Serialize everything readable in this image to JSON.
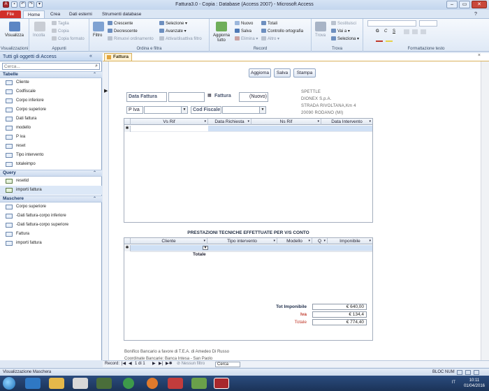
{
  "window": {
    "title": "Fattura3.0 - Copia : Database (Access 2007) - Microsoft Access",
    "controls": [
      "–",
      "▭",
      "✕"
    ]
  },
  "ribbon": {
    "tabs": [
      "File",
      "Home",
      "Crea",
      "Dati esterni",
      "Strumenti database"
    ],
    "groups": {
      "views": {
        "label": "Visualizzazioni",
        "view_button": "Visualizza"
      },
      "clipboard": {
        "label": "Appunti",
        "paste": "Incolla",
        "cut": "Taglia",
        "copy": "Copia",
        "format_painter": "Copia formato"
      },
      "sort_filter": {
        "label": "Ordina e filtra",
        "filter": "Filtro",
        "ascending": "Crescente",
        "descending": "Decrescente",
        "remove_sort": "Rimuovi ordinamento",
        "selection": "Selezione",
        "advanced": "Avanzate",
        "toggle_filter": "Attiva/disattiva filtro"
      },
      "records": {
        "label": "Record",
        "refresh": "Aggiorna tutto",
        "new": "Nuovo",
        "save": "Salva",
        "delete": "Elimina",
        "totals": "Totali",
        "spelling": "Controllo ortografia",
        "more": "Altro"
      },
      "find": {
        "label": "Trova",
        "find": "Trova",
        "replace": "Sostituisci",
        "goto": "Vai a",
        "select": "Seleziona"
      },
      "text_format": {
        "label": "Formattazione testo",
        "bold": "G",
        "italic": "C",
        "underline": "S"
      }
    }
  },
  "nav": {
    "header": "Tutti gli oggetti di Access",
    "search_placeholder": "Cerca...",
    "sections": [
      {
        "title": "Tabelle",
        "items": [
          "Cliente",
          "Codfiscale",
          "Corpo inferiore",
          "Corpo superiore",
          "Dati fattura",
          "modello",
          "P iva",
          "reset",
          "Tipo intervento",
          "totaleimpo"
        ]
      },
      {
        "title": "Query",
        "items": [
          "resetid",
          "importi fattura"
        ]
      },
      {
        "title": "Maschere",
        "items": [
          "Corpo superiore",
          "-Dati fattura-corpo inferiore",
          "-Dati fattura-corpo superiore",
          "Fattura",
          "importi fattura"
        ]
      }
    ]
  },
  "doc": {
    "tab": "Fattura",
    "buttons": {
      "update": "Aggiorna",
      "save": "Salva",
      "print": "Stampa"
    },
    "labels": {
      "data_fattura": "Data Fattura",
      "fattura": "Fattura",
      "nuovo": "(Nuovo)",
      "piva": "P Iva",
      "codfiscale": "Cod Fiscale"
    },
    "company": [
      "SPETTLE",
      "DIONEX S.p.A.",
      "STRADA RIVOLTANA,Km 4",
      "20090 RODANO (MI)"
    ],
    "upper_grid": {
      "columns": [
        "Vs Rif",
        "Data Richiesta",
        "Ns Rif",
        "Data Intervento"
      ]
    },
    "section_title": "PRESTAZIONI TECNICHE EFFETTUATE PER V/S CONTO",
    "lower_grid": {
      "columns": [
        "Cliente",
        "Tipo intervento",
        "Modello",
        "Q",
        "Imponibile"
      ],
      "footer": "Totale"
    },
    "totals": {
      "imponibile_label": "Tot Imponibile",
      "imponibile": "€ 640,00",
      "iva_label": "Iva",
      "iva": "€ 134,4",
      "totale_label": "Totale",
      "totale": "€ 774,40"
    },
    "footer_lines": [
      "Bonifico Bancario a favore di T.E.A. di Amedeo Di Russo",
      "Coordinate Bancarie: Banca Intesa - San Paolo"
    ]
  },
  "recnav": {
    "label": "Record:",
    "position": "1 di 1",
    "filter": "Nessun filtro",
    "search": "Cerca"
  },
  "status": {
    "left": "Visualizzazione Maschera",
    "right": "BLOC NUM"
  },
  "taskbar": {
    "time": "10:11",
    "date": "01/04/2016",
    "tray": "IT"
  }
}
